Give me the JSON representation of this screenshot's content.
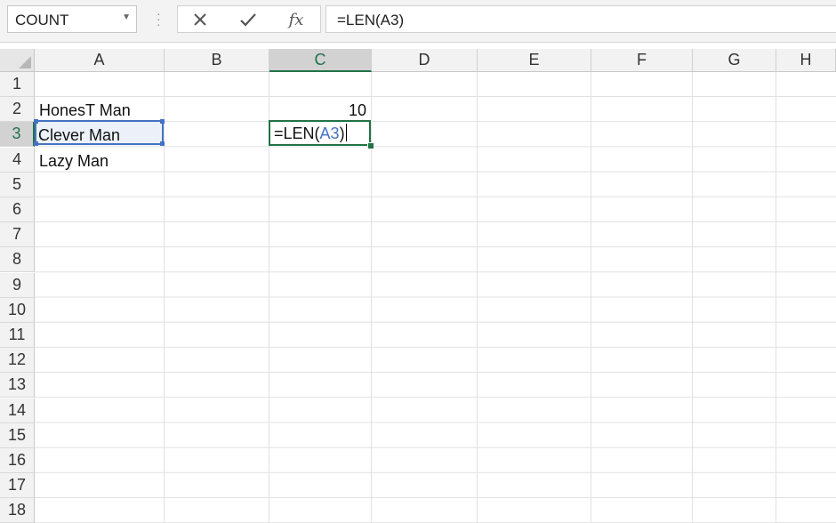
{
  "formula_bar": {
    "name_box": "COUNT",
    "cancel_icon": "close-icon",
    "enter_icon": "check-icon",
    "fx_icon": "fx-icon",
    "formula": "=LEN(A3)"
  },
  "sheet": {
    "columns": [
      "A",
      "B",
      "C",
      "D",
      "E",
      "F",
      "G",
      "H"
    ],
    "active_column": "C",
    "rows": [
      "1",
      "2",
      "3",
      "4",
      "5",
      "6",
      "7",
      "8",
      "9",
      "10",
      "11",
      "12",
      "13",
      "14",
      "15",
      "16",
      "17",
      "18"
    ],
    "active_row": "3",
    "cells": {
      "A2": "HonesT Man",
      "A3": "Clever Man",
      "A4": "Lazy Man",
      "C2": "10"
    },
    "editing_cell": {
      "prefix": "=LEN(",
      "ref": "A3",
      "suffix": ")"
    }
  },
  "colors": {
    "accent_green": "#217346",
    "reference_blue": "#4472c4"
  }
}
